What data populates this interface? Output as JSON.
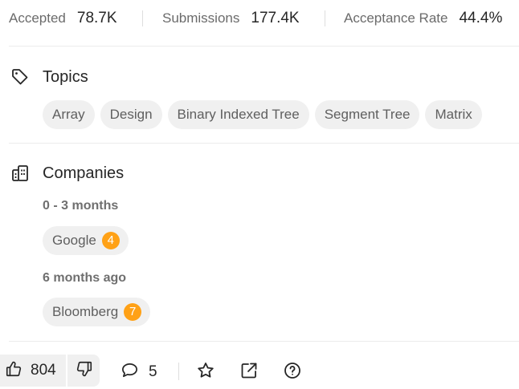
{
  "stats": {
    "accepted_label": "Accepted",
    "accepted_value": "78.7K",
    "submissions_label": "Submissions",
    "submissions_value": "177.4K",
    "acceptance_label": "Acceptance Rate",
    "acceptance_value": "44.4%"
  },
  "topics": {
    "title": "Topics",
    "icon": "tag-icon",
    "tags": [
      "Array",
      "Design",
      "Binary Indexed Tree",
      "Segment Tree",
      "Matrix"
    ]
  },
  "companies": {
    "title": "Companies",
    "icon": "building-icon",
    "groups": [
      {
        "period": "0 - 3 months",
        "companies": [
          {
            "name": "Google",
            "count": "4"
          }
        ]
      },
      {
        "period": "6 months ago",
        "companies": [
          {
            "name": "Bloomberg",
            "count": "7"
          }
        ]
      }
    ]
  },
  "toolbar": {
    "upvotes": "804",
    "comments": "5",
    "icons": [
      "thumbs-up-icon",
      "thumbs-down-icon",
      "comment-icon",
      "star-icon",
      "share-icon",
      "help-icon"
    ]
  },
  "colors": {
    "badge": "#ffa116",
    "tag_bg": "#f0f0f0"
  }
}
